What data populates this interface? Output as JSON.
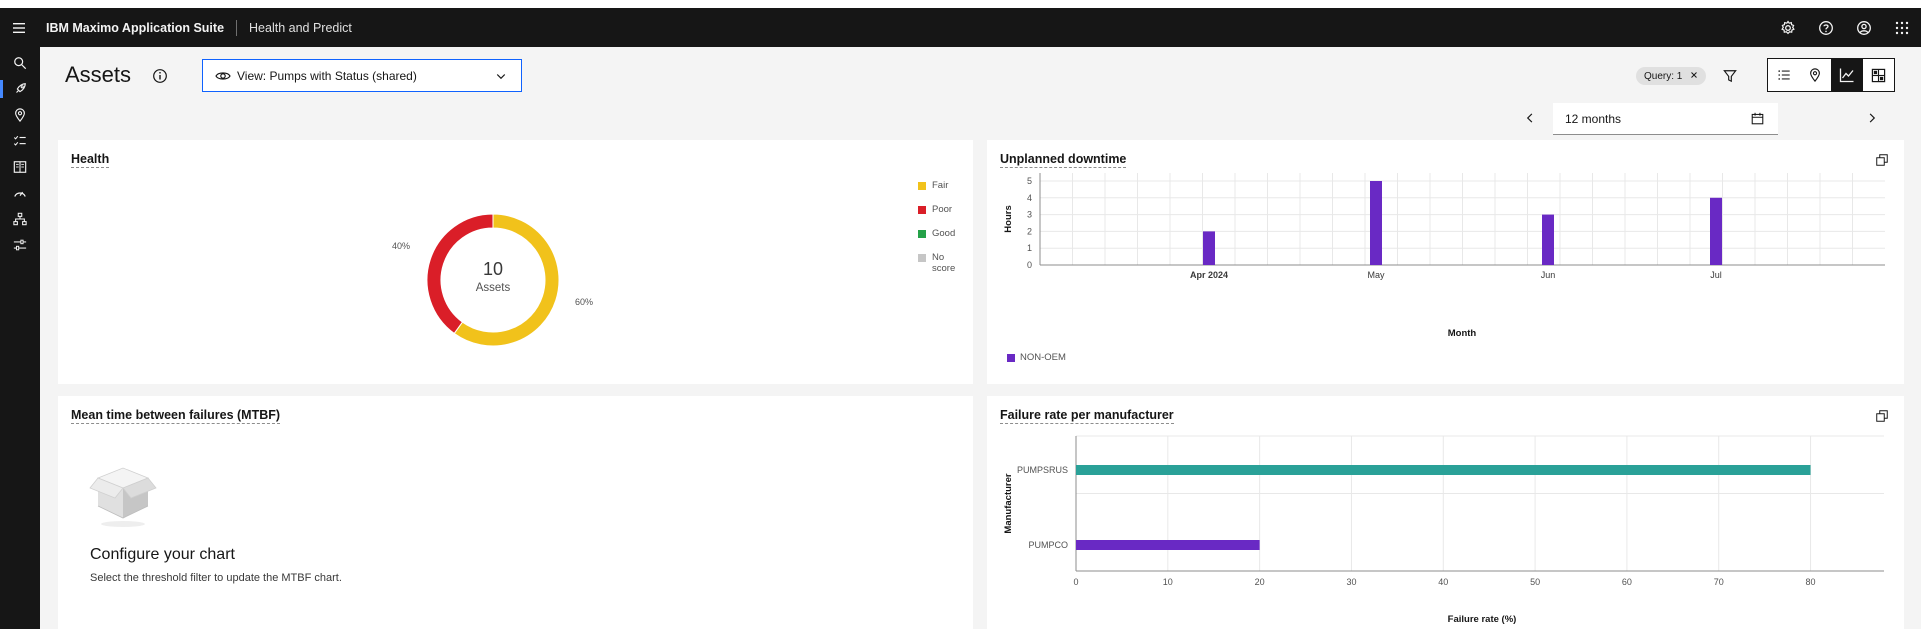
{
  "header": {
    "brand_bold": "IBM Maximo Application Suite",
    "app_name": "Health and Predict"
  },
  "page": {
    "title": "Assets",
    "view_select": "View: Pumps with Status (shared)",
    "query_tag": "Query: 1",
    "date_range": "12 months"
  },
  "sidenav": [
    "search-icon",
    "rocket-icon",
    "location-icon",
    "checklist-icon",
    "catalog-icon",
    "gauge-icon",
    "hierarchy-icon",
    "settings-adjust-icon"
  ],
  "health": {
    "title": "Health",
    "center_value": "10",
    "center_label": "Assets",
    "label_fair": "60%",
    "label_poor": "40%",
    "legend": [
      {
        "label": "Fair",
        "color": "#f1c21b"
      },
      {
        "label": "Poor",
        "color": "#da1e28"
      },
      {
        "label": "Good",
        "color": "#24a148"
      },
      {
        "label": "No score",
        "color": "#c6c6c6"
      }
    ]
  },
  "downtime": {
    "title": "Unplanned downtime",
    "legend_label": "NON-OEM",
    "legend_color": "#6929c4"
  },
  "mtbf": {
    "title": "Mean time between failures (MTBF)",
    "empty_title": "Configure your chart",
    "empty_desc": "Select the threshold filter to update the MTBF chart."
  },
  "failure": {
    "title": "Failure rate per manufacturer"
  },
  "chart_data": [
    {
      "type": "pie",
      "title": "Health",
      "categories": [
        "Fair",
        "Poor"
      ],
      "values": [
        60,
        40
      ],
      "unit": "%",
      "colors": [
        "#f1c21b",
        "#da1e28"
      ]
    },
    {
      "type": "bar",
      "title": "Unplanned downtime",
      "xlabel": "Month",
      "ylabel": "Hours",
      "ylim": [
        0,
        5
      ],
      "yticks": [
        0,
        1,
        2,
        3,
        4,
        5
      ],
      "categories": [
        "Apr 2024",
        "May",
        "Jun",
        "Jul"
      ],
      "series": [
        {
          "name": "NON-OEM",
          "values": [
            2,
            5,
            3,
            4
          ],
          "color": "#6929c4"
        }
      ]
    },
    {
      "type": "bar",
      "orientation": "horizontal",
      "title": "Failure rate per manufacturer",
      "xlabel": "Failure rate (%)",
      "ylabel": "Manufacturer",
      "xlim": [
        0,
        88
      ],
      "xticks": [
        0,
        10,
        20,
        30,
        40,
        50,
        60,
        70,
        80
      ],
      "categories": [
        "PUMPSRUS",
        "PUMPCO"
      ],
      "values": [
        80,
        20
      ],
      "colors": [
        "#2aa198",
        "#6929c4"
      ]
    }
  ]
}
